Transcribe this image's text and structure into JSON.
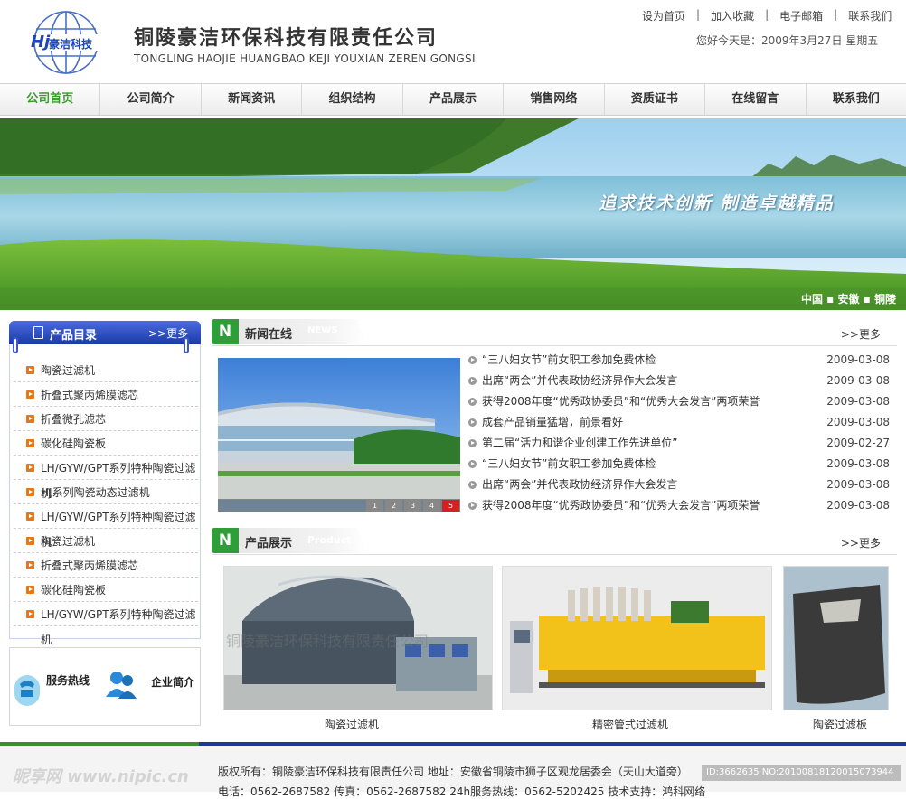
{
  "header": {
    "logo_text": "豪洁科技",
    "logo_mark": "Hj",
    "company_cn": "铜陵豪洁环保科技有限责任公司",
    "company_en": "TONGLING HAOJIE HUANGBAO KEJI YOUXIAN ZEREN GONGSI",
    "top_links": [
      "设为首页",
      "加入收藏",
      "电子邮箱",
      "联系我们"
    ],
    "separator": "|",
    "greeting": "您好今天是：2009年3月27日 星期五"
  },
  "nav": {
    "items": [
      "公司首页",
      "公司简介",
      "新闻资讯",
      "组织结构",
      "产品展示",
      "销售网络",
      "资质证书",
      "在线留言",
      "联系我们"
    ],
    "active": 0
  },
  "banner": {
    "slogan": "追求技术创新  制造卓越精品",
    "location": "中国 ▪ 安徽 ▪ 铜陵"
  },
  "sidebar": {
    "title": "产品目录",
    "more": ">>更多",
    "items": [
      "陶瓷过滤机",
      "折叠式聚丙烯膜滤芯",
      "折叠微孔滤芯",
      "碳化硅陶瓷板",
      "LH/GYW/GPT系列特种陶瓷过滤机",
      "HJ系列陶瓷动态过滤机",
      "LH/GYW/GPT系列特种陶瓷过滤机",
      "陶瓷过滤机",
      "折叠式聚丙烯膜滤芯",
      "碳化硅陶瓷板",
      "LH/GYW/GPT系列特种陶瓷过滤机"
    ],
    "service_hotline": "服务热线",
    "company_intro": "企业简介"
  },
  "news": {
    "title": "新闻在线",
    "title_en": "NEWS",
    "badge": "N",
    "more": ">>更多",
    "pages": [
      "1",
      "2",
      "3",
      "4",
      "5"
    ],
    "active_page": 4,
    "items": [
      {
        "title": "“三八妇女节”前女职工参加免费体检",
        "date": "2009-03-08"
      },
      {
        "title": "出席“两会”并代表政协经济界作大会发言",
        "date": "2009-03-08"
      },
      {
        "title": "获得2008年度“优秀政协委员”和“优秀大会发言”两项荣誉",
        "date": "2009-03-08"
      },
      {
        "title": "成套产品销量猛增，前景看好",
        "date": "2009-03-08"
      },
      {
        "title": "第二届“活力和谐企业创建工作先进单位”",
        "date": "2009-02-27"
      },
      {
        "title": "“三八妇女节”前女职工参加免费体检",
        "date": "2009-03-08"
      },
      {
        "title": "出席“两会”并代表政协经济界作大会发言",
        "date": "2009-03-08"
      },
      {
        "title": "获得2008年度“优秀政协委员”和“优秀大会发言”两项荣誉",
        "date": "2009-03-08"
      }
    ]
  },
  "products": {
    "title": "产品展示",
    "title_en": "Product",
    "badge": "N",
    "more": ">>更多",
    "items": [
      {
        "name": "陶瓷过滤机"
      },
      {
        "name": "精密管式过滤机"
      },
      {
        "name": "陶瓷过滤板"
      }
    ],
    "watermark": "铜陵豪洁环保科技有限责任公司"
  },
  "footer": {
    "line1": "版权所有：铜陵豪洁环保科技有限责任公司   地址：安徽省铜陵市狮子区观龙居委会（天山大道旁）",
    "line2": "电话：0562-2687582     传真：0562-2687582     24h服务热线：0562-5202425     技术支持：鸿科网络"
  },
  "watermarks": {
    "site": "昵享网 www.nipic.cn",
    "id": "ID:3662635 NO:20100818120015073944"
  },
  "colors": {
    "accent_green": "#3a9d2b",
    "nav_blue": "#1c3aa6",
    "bullet_orange": "#e8771a"
  }
}
